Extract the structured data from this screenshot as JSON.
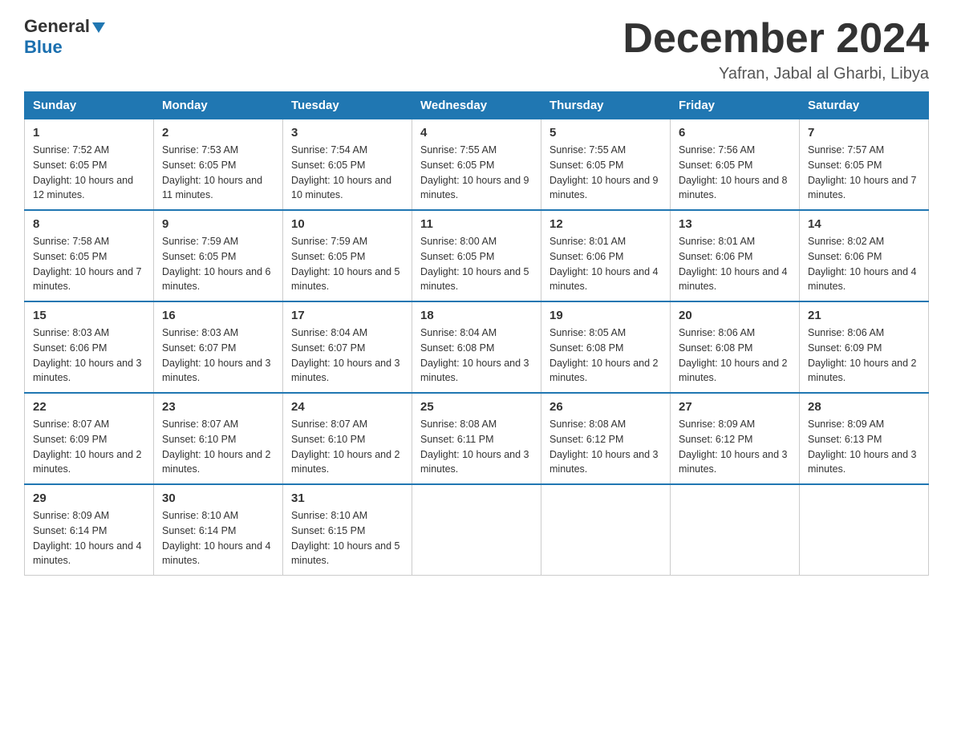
{
  "logo": {
    "line1": "General",
    "triangle": "▶",
    "line2": "Blue"
  },
  "calendar": {
    "title": "December 2024",
    "subtitle": "Yafran, Jabal al Gharbi, Libya",
    "days_of_week": [
      "Sunday",
      "Monday",
      "Tuesday",
      "Wednesday",
      "Thursday",
      "Friday",
      "Saturday"
    ],
    "weeks": [
      [
        {
          "day": 1,
          "sunrise": "7:52 AM",
          "sunset": "6:05 PM",
          "daylight": "10 hours and 12 minutes."
        },
        {
          "day": 2,
          "sunrise": "7:53 AM",
          "sunset": "6:05 PM",
          "daylight": "10 hours and 11 minutes."
        },
        {
          "day": 3,
          "sunrise": "7:54 AM",
          "sunset": "6:05 PM",
          "daylight": "10 hours and 10 minutes."
        },
        {
          "day": 4,
          "sunrise": "7:55 AM",
          "sunset": "6:05 PM",
          "daylight": "10 hours and 9 minutes."
        },
        {
          "day": 5,
          "sunrise": "7:55 AM",
          "sunset": "6:05 PM",
          "daylight": "10 hours and 9 minutes."
        },
        {
          "day": 6,
          "sunrise": "7:56 AM",
          "sunset": "6:05 PM",
          "daylight": "10 hours and 8 minutes."
        },
        {
          "day": 7,
          "sunrise": "7:57 AM",
          "sunset": "6:05 PM",
          "daylight": "10 hours and 7 minutes."
        }
      ],
      [
        {
          "day": 8,
          "sunrise": "7:58 AM",
          "sunset": "6:05 PM",
          "daylight": "10 hours and 7 minutes."
        },
        {
          "day": 9,
          "sunrise": "7:59 AM",
          "sunset": "6:05 PM",
          "daylight": "10 hours and 6 minutes."
        },
        {
          "day": 10,
          "sunrise": "7:59 AM",
          "sunset": "6:05 PM",
          "daylight": "10 hours and 5 minutes."
        },
        {
          "day": 11,
          "sunrise": "8:00 AM",
          "sunset": "6:05 PM",
          "daylight": "10 hours and 5 minutes."
        },
        {
          "day": 12,
          "sunrise": "8:01 AM",
          "sunset": "6:06 PM",
          "daylight": "10 hours and 4 minutes."
        },
        {
          "day": 13,
          "sunrise": "8:01 AM",
          "sunset": "6:06 PM",
          "daylight": "10 hours and 4 minutes."
        },
        {
          "day": 14,
          "sunrise": "8:02 AM",
          "sunset": "6:06 PM",
          "daylight": "10 hours and 4 minutes."
        }
      ],
      [
        {
          "day": 15,
          "sunrise": "8:03 AM",
          "sunset": "6:06 PM",
          "daylight": "10 hours and 3 minutes."
        },
        {
          "day": 16,
          "sunrise": "8:03 AM",
          "sunset": "6:07 PM",
          "daylight": "10 hours and 3 minutes."
        },
        {
          "day": 17,
          "sunrise": "8:04 AM",
          "sunset": "6:07 PM",
          "daylight": "10 hours and 3 minutes."
        },
        {
          "day": 18,
          "sunrise": "8:04 AM",
          "sunset": "6:08 PM",
          "daylight": "10 hours and 3 minutes."
        },
        {
          "day": 19,
          "sunrise": "8:05 AM",
          "sunset": "6:08 PM",
          "daylight": "10 hours and 2 minutes."
        },
        {
          "day": 20,
          "sunrise": "8:06 AM",
          "sunset": "6:08 PM",
          "daylight": "10 hours and 2 minutes."
        },
        {
          "day": 21,
          "sunrise": "8:06 AM",
          "sunset": "6:09 PM",
          "daylight": "10 hours and 2 minutes."
        }
      ],
      [
        {
          "day": 22,
          "sunrise": "8:07 AM",
          "sunset": "6:09 PM",
          "daylight": "10 hours and 2 minutes."
        },
        {
          "day": 23,
          "sunrise": "8:07 AM",
          "sunset": "6:10 PM",
          "daylight": "10 hours and 2 minutes."
        },
        {
          "day": 24,
          "sunrise": "8:07 AM",
          "sunset": "6:10 PM",
          "daylight": "10 hours and 2 minutes."
        },
        {
          "day": 25,
          "sunrise": "8:08 AM",
          "sunset": "6:11 PM",
          "daylight": "10 hours and 3 minutes."
        },
        {
          "day": 26,
          "sunrise": "8:08 AM",
          "sunset": "6:12 PM",
          "daylight": "10 hours and 3 minutes."
        },
        {
          "day": 27,
          "sunrise": "8:09 AM",
          "sunset": "6:12 PM",
          "daylight": "10 hours and 3 minutes."
        },
        {
          "day": 28,
          "sunrise": "8:09 AM",
          "sunset": "6:13 PM",
          "daylight": "10 hours and 3 minutes."
        }
      ],
      [
        {
          "day": 29,
          "sunrise": "8:09 AM",
          "sunset": "6:14 PM",
          "daylight": "10 hours and 4 minutes."
        },
        {
          "day": 30,
          "sunrise": "8:10 AM",
          "sunset": "6:14 PM",
          "daylight": "10 hours and 4 minutes."
        },
        {
          "day": 31,
          "sunrise": "8:10 AM",
          "sunset": "6:15 PM",
          "daylight": "10 hours and 5 minutes."
        },
        null,
        null,
        null,
        null
      ]
    ]
  }
}
